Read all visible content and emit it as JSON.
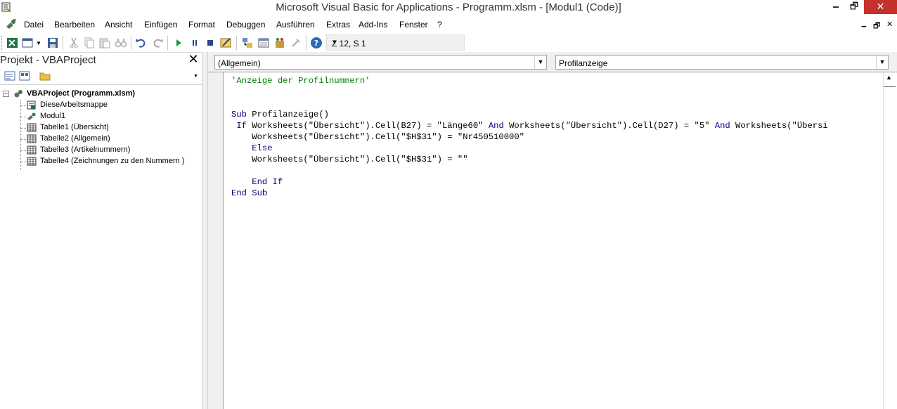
{
  "window": {
    "title": "Microsoft Visual Basic for Applications - Programm.xlsm - [Modul1 (Code)]",
    "minimize": "🗕",
    "maximize": "🗗",
    "close": "✕"
  },
  "menu": {
    "items": [
      "Datei",
      "Bearbeiten",
      "Ansicht",
      "Einfügen",
      "Format",
      "Debuggen",
      "Ausführen",
      "Extras",
      "Add-Ins",
      "Fenster",
      "?"
    ],
    "mdi_minimize": "🗕",
    "mdi_restore": "🗗",
    "mdi_close": "✕"
  },
  "toolbar": {
    "position": "Z 12, S 1"
  },
  "project": {
    "title": "Projekt - VBAProject",
    "close": "✕",
    "tree": {
      "root": "VBAProject (Programm.xlsm)",
      "items": [
        "DieseArbeitsmappe",
        "Modul1",
        "Tabelle1 (Übersicht)",
        "Tabelle2 (Allgemein)",
        "Tabelle3 (Artikelnummern)",
        "Tabelle4 (Zeichnungen zu den Nummern )"
      ]
    }
  },
  "code": {
    "object_combo": "(Allgemein)",
    "procedure_combo": "Profilanzeige",
    "lines": [
      "'Anzeige der Profilnummern'",
      "",
      "",
      "Sub Profilanzeige()",
      " If Worksheets(\"Übersicht\").Cell(B27) = \"Länge60\" And Worksheets(\"Übersicht\").Cell(D27) = \"5\" And Worksheets(\"Übersi",
      "    Worksheets(\"Übersicht\").Cell(\"$H$31\") = \"Nr450510000\"",
      "    Else",
      "    Worksheets(\"Übersicht\").Cell(\"$H$31\") = \"\"",
      "",
      "    End If",
      "End Sub"
    ]
  },
  "colors": {
    "keyword": "#00007f",
    "comment": "#008000",
    "close_button": "#c7312b"
  }
}
